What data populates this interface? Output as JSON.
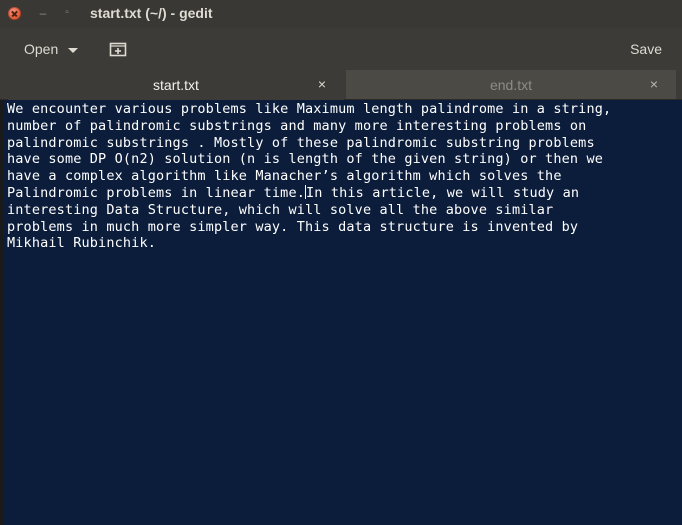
{
  "window": {
    "title": "start.txt (~/) - gedit",
    "min_glyph": "–",
    "max_glyph": "▫"
  },
  "toolbar": {
    "open_label": "Open",
    "save_label": "Save"
  },
  "tabs": [
    {
      "label": "start.txt",
      "close": "×",
      "active": true
    },
    {
      "label": "end.txt",
      "close": "×",
      "active": false
    }
  ],
  "editor": {
    "lines_before_cursor": [
      "We encounter various problems like Maximum length palindrome in a string,",
      "number of palindromic substrings and many more interesting problems on",
      "palindromic substrings . Mostly of these palindromic substring problems",
      "have some DP O(n2) solution (n is length of the given string) or then we",
      "have a complex algorithm like Manacher’s algorithm which solves the"
    ],
    "cursor_line_before": "Palindromic problems in linear time.",
    "cursor_line_after": "In this article, we will study an",
    "lines_after_cursor": [
      "interesting Data Structure, which will solve all the above similar",
      "problems in much more simpler way. This data structure is invented by",
      "Mikhail Rubinchik."
    ]
  },
  "colors": {
    "editor_background": "#0c1d3b",
    "editor_text": "#ffffff",
    "chrome": "#3c3b37",
    "close_button": "#e9603e"
  },
  "icons": {
    "window_close": "close-icon",
    "new_tab": "new-tab-icon",
    "open_dropdown": "chevron-down-icon"
  }
}
